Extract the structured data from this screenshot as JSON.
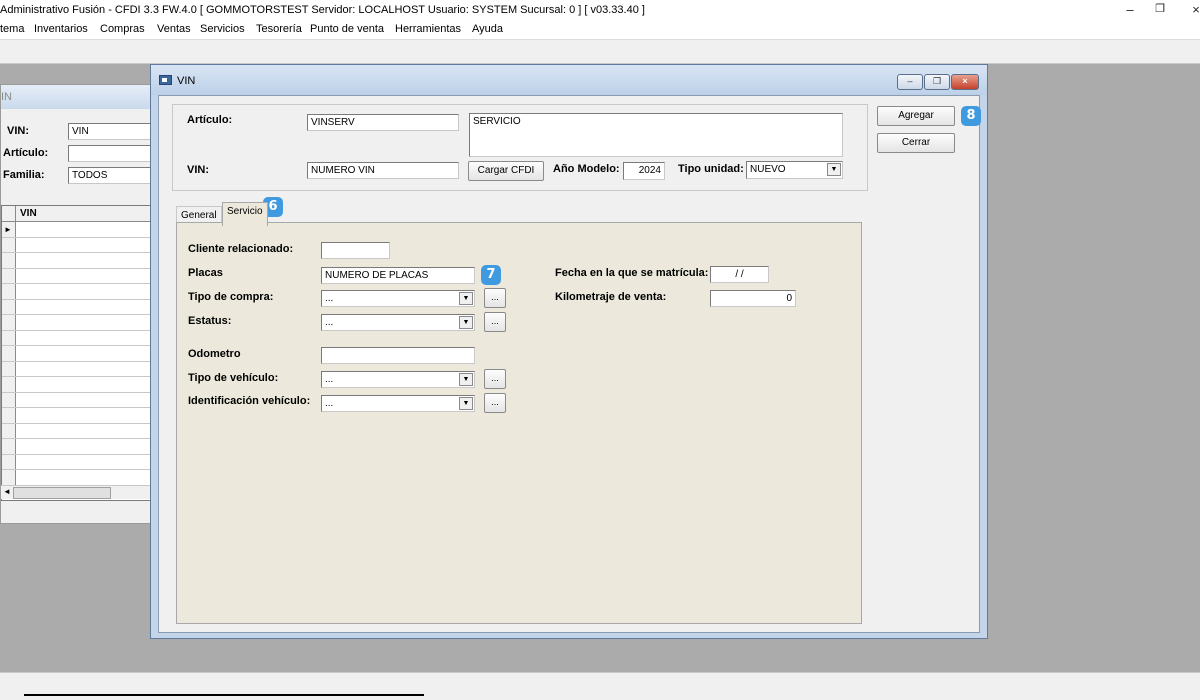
{
  "app": {
    "title": "Administrativo Fusión - CFDI 3.3 FW.4.0 [ GOMMOTORSTEST  Servidor: LOCALHOST   Usuario: SYSTEM    Sucursal: 0 ] [ v03.33.40 ]",
    "window_controls": {
      "minimize": "–",
      "restore": "❐",
      "close": "×"
    }
  },
  "menu": {
    "items": [
      "tema",
      "Inventarios",
      "Compras",
      "Ventas",
      "Servicios",
      "Tesorería",
      "Punto de venta",
      "Herramientas",
      "Ayuda"
    ]
  },
  "bg_window": {
    "title": "IN",
    "vin_label": "VIN:",
    "vin_value": "VIN",
    "articulo_label": "Artículo:",
    "articulo_value": "",
    "familia_label": "Familia:",
    "familia_value": "TODOS",
    "grid_header": "VIN",
    "row_marker": "►"
  },
  "dialog": {
    "title": "VIN",
    "articulo_label": "Artículo:",
    "articulo_code": "VINSERV",
    "articulo_desc": "SERVICIO",
    "vin_label": "VIN:",
    "vin_value": "NUMERO VIN",
    "cargar_cfdi": "Cargar CFDI",
    "anio_modelo_label": "Año Modelo:",
    "anio_modelo_value": "2024",
    "tipo_unidad_label": "Tipo unidad:",
    "tipo_unidad_value": "NUEVO",
    "agregar": "Agregar",
    "cerrar": "Cerrar",
    "tabs": [
      "General",
      "Servicio"
    ],
    "active_tab": "Servicio"
  },
  "servicio": {
    "cliente_label": "Cliente relacionado:",
    "cliente_value": "",
    "placas_label": "Placas",
    "placas_value": "NUMERO DE PLACAS",
    "tipo_compra_label": "Tipo de compra:",
    "tipo_compra_value": "...",
    "estatus_label": "Estatus:",
    "estatus_value": "...",
    "odometro_label": "Odometro",
    "odometro_value": "",
    "tipo_vehiculo_label": "Tipo de vehículo:",
    "tipo_vehiculo_value": "...",
    "identificacion_label": "Identificación vehículo:",
    "identificacion_value": "...",
    "fecha_label": "Fecha en la que se matrícula:",
    "fecha_value": " / /",
    "kilometraje_label": "Kilometraje de venta:",
    "kilometraje_value": "0",
    "ellipsis": "..."
  },
  "badges": {
    "tab": "6",
    "placas": "7",
    "agregar": "8"
  },
  "colors": {
    "badge": "#3f9ae0",
    "panel": "#ece9dc",
    "dialog_frame": "#c4d5ea"
  },
  "icons": {
    "dropdown": "▼",
    "scroll_left": "◄"
  }
}
